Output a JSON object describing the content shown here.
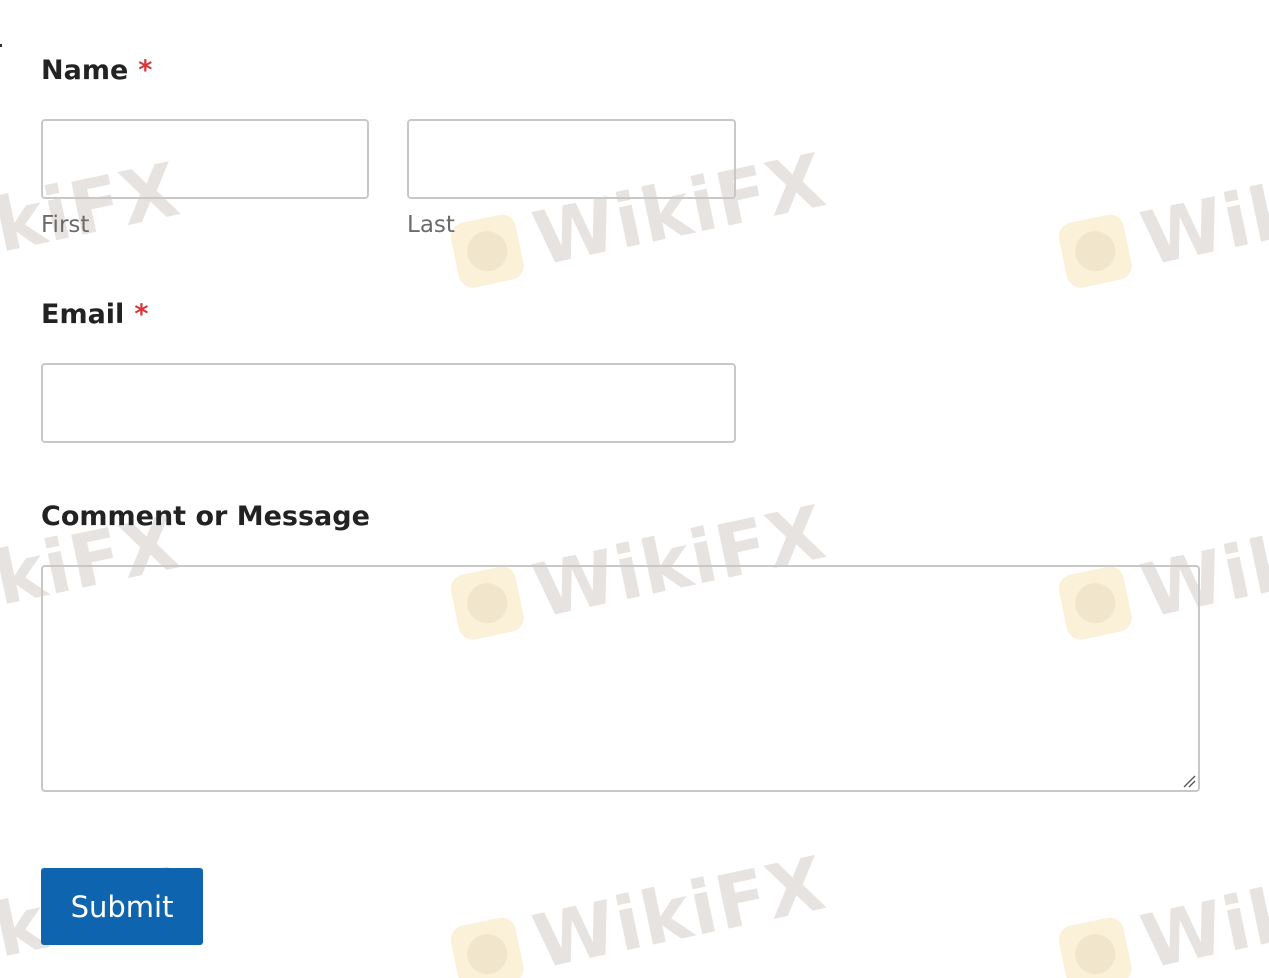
{
  "form": {
    "name": {
      "label": "Name",
      "required_mark": "*",
      "first": {
        "value": "",
        "sublabel": "First"
      },
      "last": {
        "value": "",
        "sublabel": "Last"
      }
    },
    "email": {
      "label": "Email",
      "required_mark": "*",
      "value": ""
    },
    "comment": {
      "label": "Comment or Message",
      "value": ""
    },
    "submit_label": "Submit"
  },
  "watermark": {
    "text": "WikiFX",
    "partial_texts": [
      "ikiFX",
      "Wik"
    ],
    "color": "#e7e3e1",
    "logo_color": "#fbf1d9",
    "icon": "wikifx-eagle-logo"
  },
  "colors": {
    "required": "#d63638",
    "button": "#0f64b0",
    "border": "#c8c8c8",
    "sublabel": "#6b6b6b"
  }
}
